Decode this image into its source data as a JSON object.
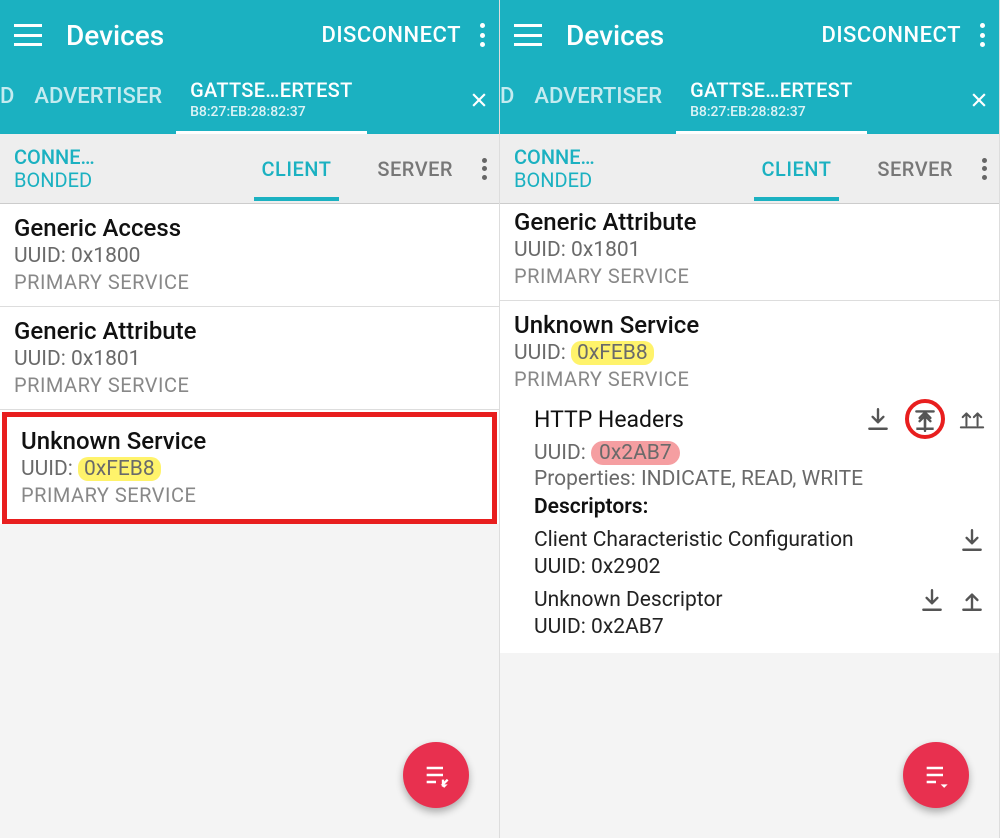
{
  "topbar": {
    "title": "Devices",
    "disconnect": "DISCONNECT"
  },
  "tabs1": {
    "partial": "D",
    "advertiser": "ADVERTISER",
    "device_name": "GATTSE…ERTEST",
    "device_mac": "B8:27:EB:28:82:37"
  },
  "tabs2": {
    "conn_line1": "CONNE…",
    "conn_line2": "BONDED",
    "client": "CLIENT",
    "server": "SERVER"
  },
  "left": {
    "services": [
      {
        "name": "Generic Access",
        "uuid_label": "UUID:",
        "uuid": "0x1800",
        "type": "PRIMARY SERVICE"
      },
      {
        "name": "Generic Attribute",
        "uuid_label": "UUID:",
        "uuid": "0x1801",
        "type": "PRIMARY SERVICE"
      },
      {
        "name": "Unknown Service",
        "uuid_label": "UUID:",
        "uuid": "0xFEB8",
        "type": "PRIMARY SERVICE",
        "highlight_uuid": true,
        "boxed": true
      }
    ]
  },
  "right": {
    "svc_ga": {
      "name": "Generic Attribute",
      "uuid_label": "UUID:",
      "uuid": "0x1801",
      "type": "PRIMARY SERVICE"
    },
    "svc_unknown": {
      "name": "Unknown Service",
      "uuid_label": "UUID:",
      "uuid": "0xFEB8",
      "type": "PRIMARY SERVICE"
    },
    "char": {
      "name": "HTTP Headers",
      "uuid_label": "UUID:",
      "uuid": "0x2AB7",
      "props_label": "Properties:",
      "props": "INDICATE, READ, WRITE",
      "desc_label": "Descriptors:",
      "desc1_name": "Client Characteristic Configuration",
      "desc1_uuid_label": "UUID:",
      "desc1_uuid": "0x2902",
      "desc2_name": "Unknown Descriptor",
      "desc2_uuid_label": "UUID:",
      "desc2_uuid": "0x2AB7"
    }
  }
}
